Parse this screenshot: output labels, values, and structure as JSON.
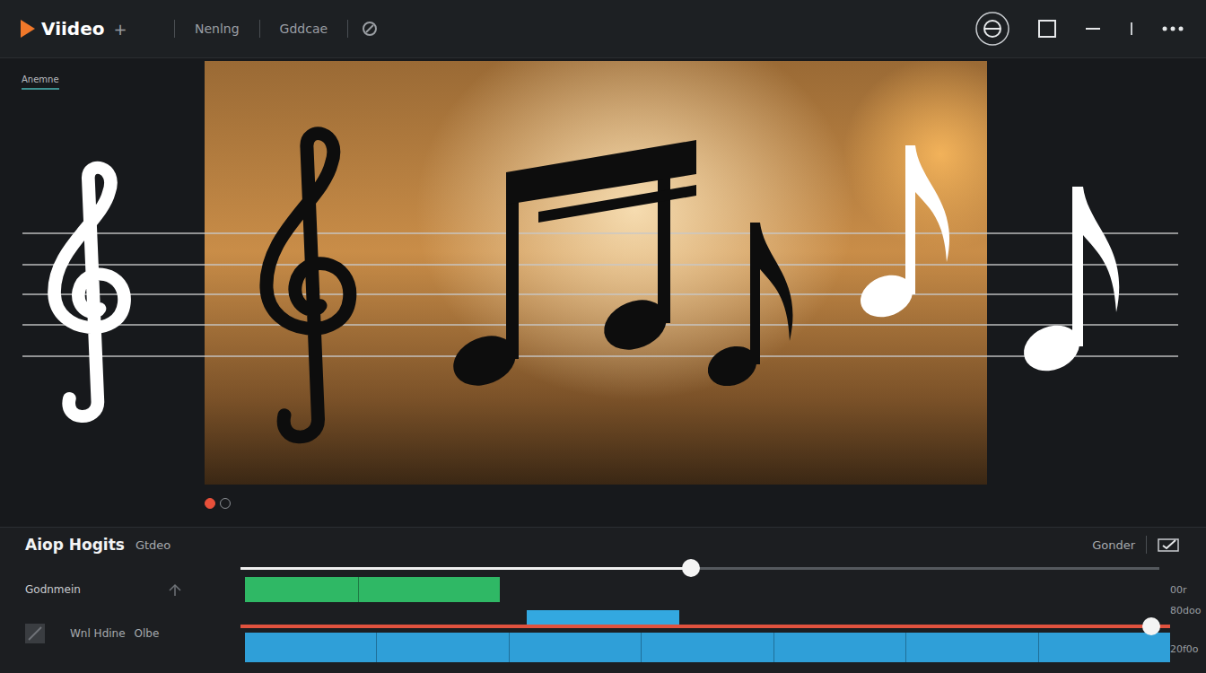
{
  "window": {
    "title": "Viideo",
    "add": "+"
  },
  "tabs": [
    {
      "label": "Nenlng",
      "selected": false
    },
    {
      "label": "Gddcae",
      "selected": false
    }
  ],
  "side_panel": {
    "label": "Anemne"
  },
  "pager": [
    {
      "selected": true
    },
    {
      "selected": false
    }
  ],
  "timeline": {
    "title": "Aiop Hogits",
    "subtitle": "Gtdeo",
    "right_label": "Gonder",
    "scrubber_level": 0.49,
    "tracks": [
      {
        "kind": "video",
        "name": "Godnmein",
        "extra": "",
        "readings": [
          "00r"
        ],
        "level": 0,
        "clips": [
          {
            "color": "#2fb865"
          }
        ]
      },
      {
        "kind": "audio",
        "name": "Wnl Hdine",
        "extra": "Olbe",
        "readings": [
          "80doo",
          "20f0o"
        ],
        "level": 0.98,
        "clips": [
          {
            "color": "#33a8e0"
          },
          {
            "color": "#2f9fd8"
          }
        ]
      }
    ]
  }
}
